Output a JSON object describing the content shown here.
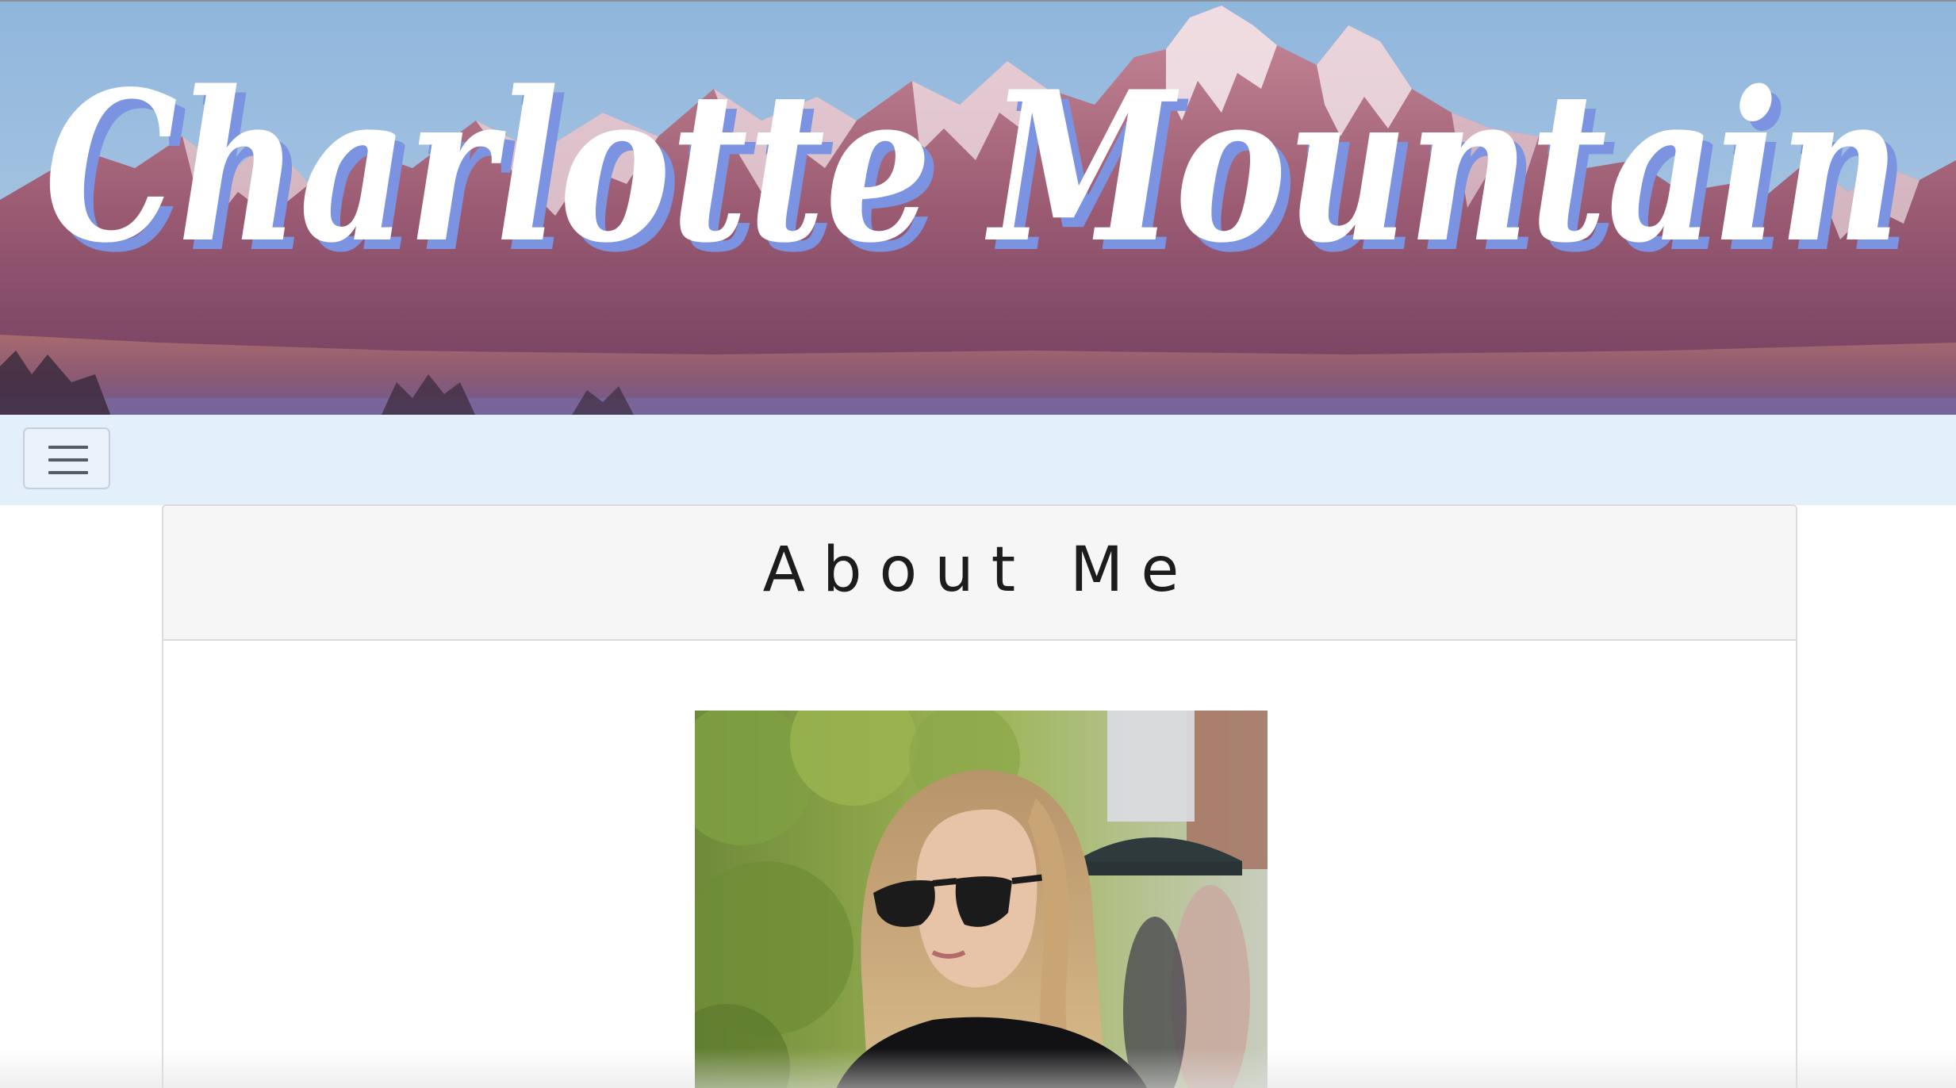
{
  "banner": {
    "title": "Charlotte Mountain",
    "image_icon": "mountain-range-photo",
    "title_color": "#ffffff",
    "title_shadow_color": "#7b93e0"
  },
  "navbar": {
    "menu_icon": "hamburger-menu-icon",
    "background": "#e4effc"
  },
  "card": {
    "title": "About Me",
    "photo_icon": "portrait-photo"
  }
}
